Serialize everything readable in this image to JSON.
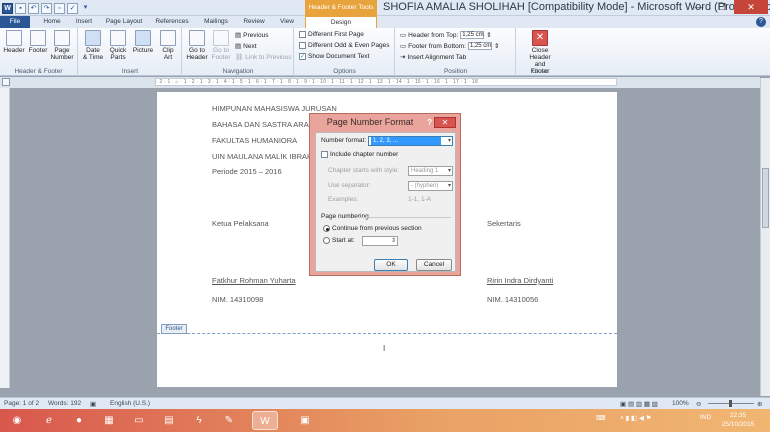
{
  "colors": {
    "accent": "#2b5797",
    "context_tab": "#e8a33d",
    "dialog_frame": "#e9a59b",
    "close_red": "#d9534f"
  },
  "window": {
    "title": "SHOFIA AMALIA SHOLIHAH [Compatibility Mode] - Microsoft Word (Product Activ...",
    "context_tab_title": "Header & Footer Tools",
    "qat_icons": [
      "word-icon",
      "save-icon",
      "undo-icon",
      "redo-icon",
      "print-preview-icon",
      "spelling-icon",
      "customize-icon"
    ]
  },
  "tabs": [
    "File",
    "Home",
    "Insert",
    "Page Layout",
    "References",
    "Mailings",
    "Review",
    "View",
    "Design"
  ],
  "ribbon": {
    "hf_group": {
      "label": "Header & Footer",
      "header": "Header",
      "footer": "Footer",
      "page_number": "Page\nNumber"
    },
    "insert_group": {
      "label": "Insert",
      "date_time": "Date\n& Time",
      "quick_parts": "Quick\nParts",
      "picture": "Picture",
      "clip_art": "Clip\nArt"
    },
    "nav_group": {
      "label": "Navigation",
      "go_to_header": "Go to\nHeader",
      "go_to_footer": "Go to\nFooter",
      "previous": "Previous",
      "next": "Next",
      "link_to_previous": "Link to Previous"
    },
    "options_group": {
      "label": "Options",
      "different_first_page": "Different First Page",
      "different_odd_even": "Different Odd & Even Pages",
      "show_document_text": "Show Document Text"
    },
    "position_group": {
      "label": "Position",
      "header_from_top": "Header from Top:",
      "header_value": "1,25 cm",
      "footer_from_bottom": "Footer from Bottom:",
      "footer_value": "1,25 cm",
      "insert_alignment_tab": "Insert Alignment Tab"
    },
    "close_group": {
      "label": "Close",
      "close_header_footer": "Close Header\nand Footer"
    }
  },
  "ruler": {
    "ticks": "· 2 · 1 · ⌂ · 1 · 2 · 1 · 3 · 1 · 4 · 1 · 5 · 1 · 6 · 1 · 7 · 1 · 8 · 1 · 9 · 1 · 10 · 1 · 11 · 1 · 12 · 1 · 13 · 1 · 14 · 1 · 15 · 1 · 16 · 1 · 17 · 1 · 18"
  },
  "document": {
    "lines": [
      "HIMPUNAN MAHASISWA JURUSAN",
      "BAHASA DAN SASTRA ARAB",
      "FAKULTAS HUMANIORA",
      "UIN MAULANA MALIK IBRAH",
      "Periode 2015 – 2016"
    ],
    "left_role": "Ketua Pelaksana",
    "right_role": "Sekertaris",
    "left_name": "Fatkhur Rohman Yuharta",
    "right_name": "Ririn Indra Dirdyanti",
    "left_nim": "NIM. 14310098",
    "right_nim": "NIM. 14310056",
    "footer_tag": "Footer",
    "footer_cursor": "I"
  },
  "dialog": {
    "title": "Page Number Format",
    "help": "?",
    "close": "✕",
    "number_format_label": "Number format:",
    "number_format_value": "1, 2, 3, ...",
    "include_chapter_number": "Include chapter number",
    "chapter_starts_label": "Chapter starts with style:",
    "chapter_starts_value": "Heading 1",
    "use_separator_label": "Use separator:",
    "use_separator_value": "-  (hyphen)",
    "examples_label": "Examples:",
    "examples_value": "1-1, 1-A",
    "page_numbering_label": "Page numbering",
    "continue_label": "Continue from previous section",
    "start_at_label": "Start at:",
    "ok": "OK",
    "cancel": "Cancel"
  },
  "status": {
    "page": "Page: 1 of 2",
    "words": "Words: 192",
    "language": "English (U.S.)",
    "zoom": "100%"
  },
  "taskbar": {
    "apps": [
      "ie-icon",
      "firefox-icon",
      "calendar-icon",
      "explorer-icon",
      "media-icon",
      "app-icon",
      "tool-icon",
      "word-icon",
      "window-icon"
    ],
    "tray_lang": "IND",
    "time": "22:35",
    "date": "25/10/2015"
  }
}
